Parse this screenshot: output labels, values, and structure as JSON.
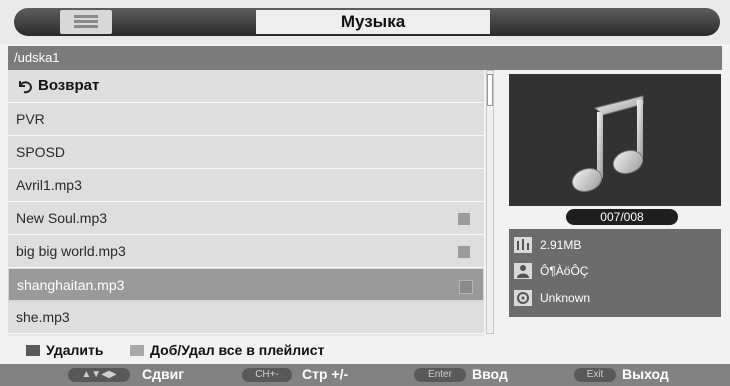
{
  "title": "Музыка",
  "path": "/udska1",
  "files": [
    {
      "label": "Возврат",
      "type": "back"
    },
    {
      "label": "PVR",
      "type": "folder"
    },
    {
      "label": "SPOSD",
      "type": "folder"
    },
    {
      "label": "Avril1.mp3",
      "type": "file"
    },
    {
      "label": "New Soul.mp3",
      "type": "file",
      "checkbox": true
    },
    {
      "label": "big big world.mp3",
      "type": "file",
      "checkbox": true
    },
    {
      "label": "shanghaitan.mp3",
      "type": "file",
      "checkbox": true,
      "selected": true
    },
    {
      "label": "she.mp3",
      "type": "file"
    }
  ],
  "counter": "007/008",
  "info": {
    "size": "2.91MB",
    "artist": "Ô¶ÀöÔÇ",
    "album": "Unknown"
  },
  "legend": {
    "delete": "Удалить",
    "toggle_all": "Доб/Удал все в плейлист"
  },
  "hints": [
    {
      "key": "▲▼◀▶",
      "label": "Сдвиг"
    },
    {
      "key": "CH+-",
      "label": "Стр +/-"
    },
    {
      "key": "Enter",
      "label": "Ввод"
    },
    {
      "key": "Exit",
      "label": "Выход"
    }
  ],
  "colors": {
    "accent": "#7b7b7b",
    "selected_row": "#9a9a9a"
  },
  "icons": {
    "title": "list-icon",
    "back": "return-arrow-icon",
    "art": "music-note-icon"
  }
}
